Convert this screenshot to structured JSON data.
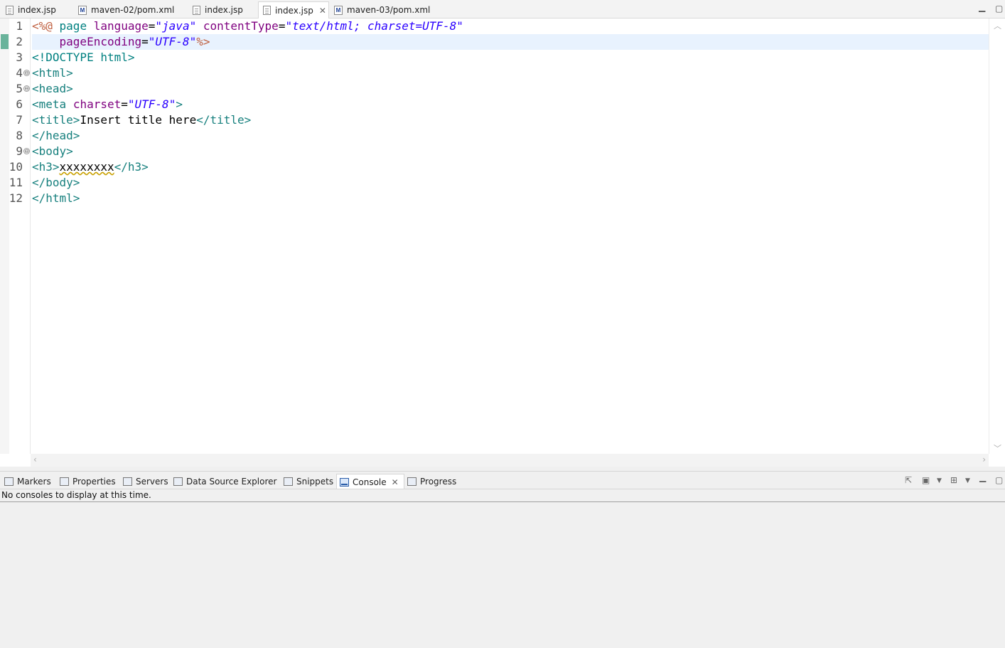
{
  "editor_tabs": [
    {
      "label": "index.jsp",
      "icon": "jsp-file-icon"
    },
    {
      "label": "maven-02/pom.xml",
      "icon": "maven-pom-icon"
    },
    {
      "label": "index.jsp",
      "icon": "jsp-file-icon"
    },
    {
      "label": "index.jsp",
      "icon": "jsp-file-icon",
      "active": true
    },
    {
      "label": "maven-03/pom.xml",
      "icon": "maven-pom-icon"
    }
  ],
  "editor": {
    "line_numbers": [
      "1",
      "2",
      "3",
      "4",
      "5",
      "6",
      "7",
      "8",
      "9",
      "10",
      "11",
      "12"
    ],
    "fold_glyph": "⊖",
    "code": {
      "l1": {
        "open": "<%@",
        "page": " page ",
        "a1": "language",
        "eq1": "=",
        "v1": "\"java\"",
        "sp": " ",
        "a2": "contentType",
        "eq2": "=",
        "v2": "\"text/html; charset=UTF-8\""
      },
      "l2": {
        "indent": "    ",
        "a1": "pageEncoding",
        "eq1": "=",
        "v1": "\"UTF-8\"",
        "close": "%>"
      },
      "l3": {
        "doctype": "<!DOCTYPE html>"
      },
      "l4": {
        "tag": "<html>"
      },
      "l5": {
        "tag": "<head>"
      },
      "l6": {
        "open": "<meta",
        "sp": " ",
        "a1": "charset",
        "eq1": "=",
        "v1": "\"UTF-8\"",
        "close": ">"
      },
      "l7": {
        "open": "<title>",
        "text": "Insert title here",
        "close": "</title>"
      },
      "l8": {
        "tag": "</head>"
      },
      "l9": {
        "tag": "<body>"
      },
      "l10": {
        "open": "<h3>",
        "text": "xxxxxxxx",
        "close": "</h3>"
      },
      "l11": {
        "tag": "</body>"
      },
      "l12": {
        "tag": "</html>"
      }
    }
  },
  "panel_tabs": [
    {
      "label": "Markers",
      "icon": "markers-icon"
    },
    {
      "label": "Properties",
      "icon": "properties-icon"
    },
    {
      "label": "Servers",
      "icon": "servers-icon"
    },
    {
      "label": "Data Source Explorer",
      "icon": "data-source-icon"
    },
    {
      "label": "Snippets",
      "icon": "snippets-icon"
    },
    {
      "label": "Console",
      "icon": "console-icon",
      "active": true
    },
    {
      "label": "Progress",
      "icon": "progress-icon"
    }
  ],
  "console": {
    "message": "No consoles to display at this time."
  },
  "colors": {
    "tag": "#17807e",
    "attribute": "#7f007f",
    "value": "#2a00ff",
    "directive": "#bf5f3f",
    "current_line": "#e8f2fe"
  }
}
